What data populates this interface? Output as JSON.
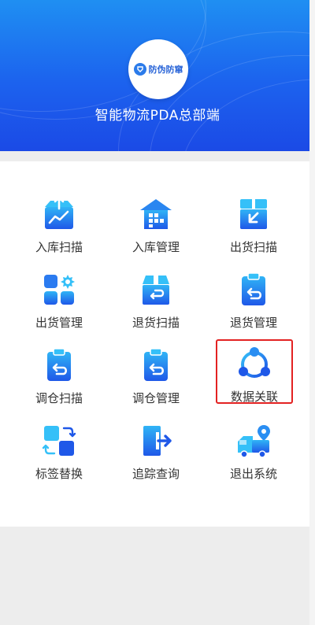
{
  "header": {
    "logo_text": "防伪防窜",
    "title": "智能物流PDA总部端"
  },
  "menu": [
    {
      "label": "入库扫描",
      "icon": "inbound-scan-icon"
    },
    {
      "label": "入库管理",
      "icon": "inbound-management-icon"
    },
    {
      "label": "出货扫描",
      "icon": "outbound-scan-icon"
    },
    {
      "label": "出货管理",
      "icon": "outbound-management-icon"
    },
    {
      "label": "退货扫描",
      "icon": "return-scan-icon"
    },
    {
      "label": "退货管理",
      "icon": "return-management-icon"
    },
    {
      "label": "调仓扫描",
      "icon": "transfer-scan-icon"
    },
    {
      "label": "调仓管理",
      "icon": "transfer-management-icon"
    },
    {
      "label": "数据关联",
      "icon": "data-link-icon",
      "highlighted": true
    },
    {
      "label": "标签替换",
      "icon": "label-replace-icon"
    },
    {
      "label": "追踪查询",
      "icon": "trace-query-icon"
    },
    {
      "label": "退出系统",
      "icon": "logout-system-icon"
    }
  ],
  "colors": {
    "header_top": "#1f8ff2",
    "header_bottom": "#1b4ae6",
    "icon_light": "#2fb2f5",
    "icon_dark": "#1f58e8",
    "highlight": "#e32222",
    "page_background": "#ededed"
  }
}
